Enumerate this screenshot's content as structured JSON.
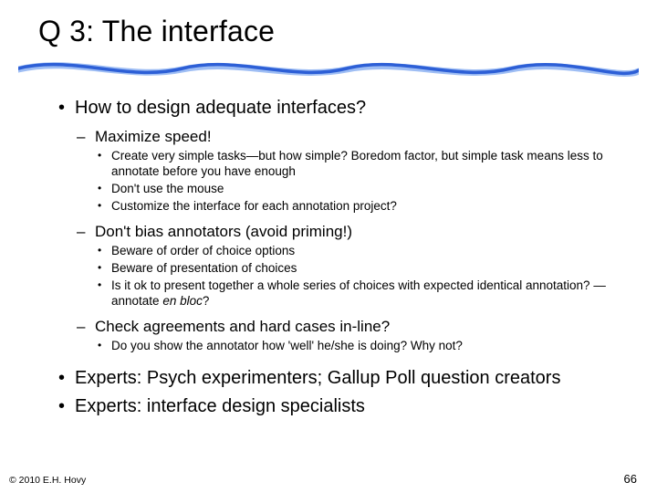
{
  "title": "Q 3: The interface",
  "bullets": {
    "b1": "How to design adequate interfaces?",
    "b1_1": "Maximize speed!",
    "b1_1_1": "Create very simple tasks—but how simple?  Boredom factor, but simple task means less to annotate before you have enough",
    "b1_1_2": "Don't use the mouse",
    "b1_1_3": "Customize the interface for each annotation project?",
    "b1_2": "Don't bias annotators (avoid priming!)",
    "b1_2_1": "Beware of order of choice options",
    "b1_2_2": "Beware of presentation of choices",
    "b1_2_3a": "Is it ok to present together a whole series of choices with expected identical annotation? — annotate ",
    "b1_2_3b": "en bloc",
    "b1_2_3c": "?",
    "b1_3": "Check agreements and hard cases in-line?",
    "b1_3_1": "Do you show the annotator how 'well' he/she is doing? Why not?",
    "b2": "Experts: Psych experimenters; Gallup Poll question creators",
    "b3": "Experts: interface design specialists"
  },
  "footer": {
    "left": "© 2010  E.H. Hovy",
    "right": "66"
  },
  "colors": {
    "wave": "#2d5fd6",
    "wave_light": "#9fbef4"
  }
}
